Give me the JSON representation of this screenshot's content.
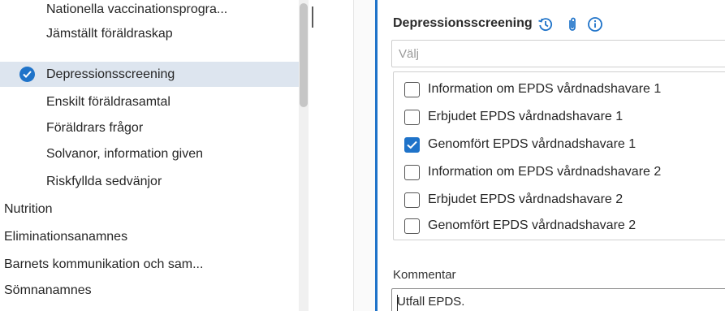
{
  "sidebar": {
    "items": [
      {
        "label": "Nationella vaccinationsprogra...",
        "level": "sub",
        "active": false
      },
      {
        "label": "Jämställt föräldraskap",
        "level": "sub",
        "active": false
      },
      {
        "label": "Depressionsscreening",
        "level": "sub",
        "active": true
      },
      {
        "label": "Enskilt föräldrasamtal",
        "level": "sub",
        "active": false
      },
      {
        "label": "Föräldrars frågor",
        "level": "sub",
        "active": false
      },
      {
        "label": "Solvanor, information given",
        "level": "sub",
        "active": false
      },
      {
        "label": "Riskfyllda sedvänjor",
        "level": "sub",
        "active": false
      },
      {
        "label": "Nutrition",
        "level": "top",
        "active": false
      },
      {
        "label": "Eliminationsanamnes",
        "level": "top",
        "active": false
      },
      {
        "label": "Barnets kommunikation och sam...",
        "level": "top",
        "active": false
      },
      {
        "label": "Sömnanamnes",
        "level": "top",
        "active": false
      }
    ]
  },
  "form": {
    "section_title": "Depressionsscreening",
    "header_icons": [
      "history-icon",
      "paperclip-icon",
      "info-icon"
    ],
    "select_placeholder": "Välj",
    "options": [
      {
        "label": "Information om EPDS vårdnadshavare 1",
        "checked": false
      },
      {
        "label": "Erbjudet EPDS vårdnadshavare 1",
        "checked": false
      },
      {
        "label": "Genomfört EPDS vårdnadshavare 1",
        "checked": true
      },
      {
        "label": "Information om EPDS vårdnadshavare 2",
        "checked": false
      },
      {
        "label": "Erbjudet EPDS vårdnadshavare 2",
        "checked": false
      },
      {
        "label": "Genomfört EPDS vårdnadshavare 2",
        "checked": false
      }
    ],
    "comment_label": "Kommentar",
    "comment_value": "Utfall EPDS."
  },
  "colors": {
    "accent": "#1f73c9",
    "active_row": "#dde5ef"
  }
}
